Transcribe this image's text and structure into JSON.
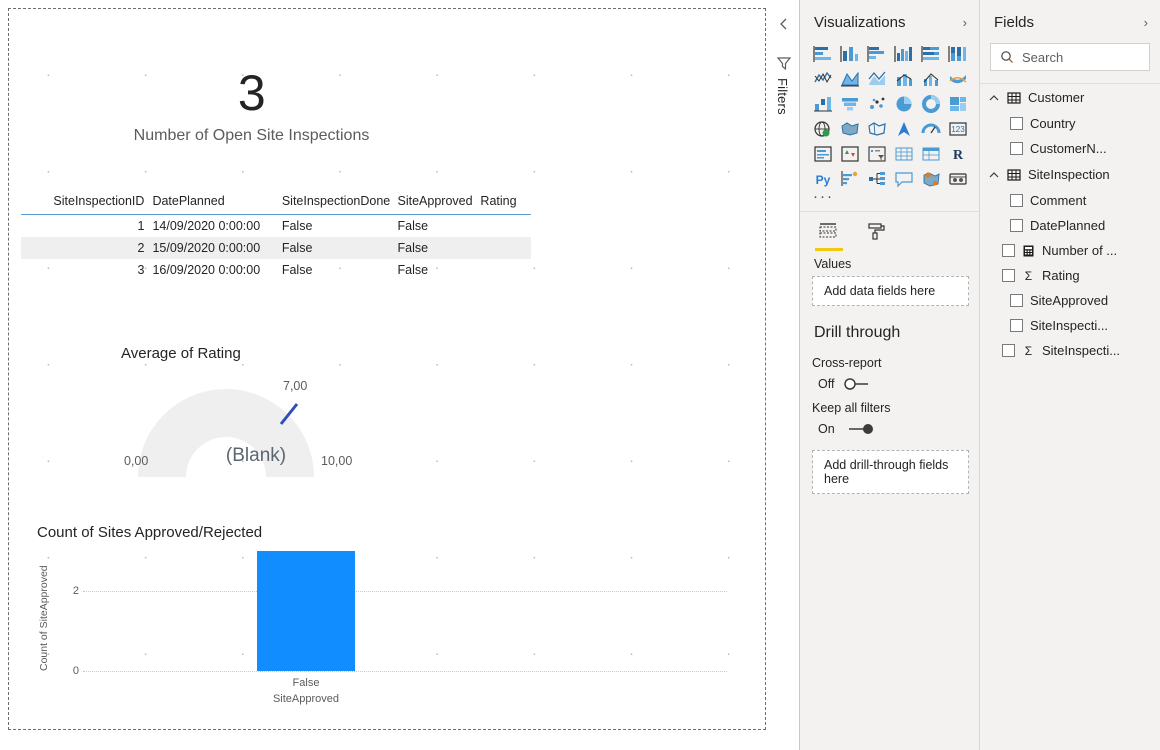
{
  "canvas": {
    "card": {
      "value": "3",
      "label": "Number of Open Site Inspections"
    },
    "table": {
      "columns": [
        "SiteInspectionID",
        "DatePlanned",
        "SiteInspectionDone",
        "SiteApproved",
        "Rating"
      ],
      "rows": [
        [
          "1",
          "14/09/2020 0:00:00",
          "False",
          "False",
          ""
        ],
        [
          "2",
          "15/09/2020 0:00:00",
          "False",
          "False",
          ""
        ],
        [
          "3",
          "16/09/2020 0:00:00",
          "False",
          "False",
          ""
        ]
      ]
    },
    "gauge": {
      "title": "Average of Rating",
      "center_value": "(Blank)",
      "min_label": "0,00",
      "max_label": "10,00",
      "target_label": "7,00"
    },
    "bar_chart": {
      "title": "Count of Sites Approved/Rejected"
    }
  },
  "chart_data": [
    {
      "type": "bar",
      "title": "Count of Sites Approved/Rejected",
      "categories": [
        "False"
      ],
      "values": [
        3
      ],
      "xlabel": "SiteApproved",
      "ylabel": "Count of SiteApproved",
      "ylim": [
        0,
        3.2
      ],
      "yticks": [
        "0",
        "2"
      ],
      "ytick_values": [
        0,
        2
      ],
      "grid": true,
      "legend": "none",
      "bar_color": "#118DFF"
    },
    {
      "type": "gauge",
      "title": "Average of Rating",
      "value": null,
      "value_label": "(Blank)",
      "min": 0,
      "max": 10,
      "target": 7,
      "min_label": "0,00",
      "max_label": "10,00",
      "target_label": "7,00",
      "arc_color": "#EFEFEF",
      "target_color": "#2F4FB8"
    }
  ],
  "filters_rail": {
    "expand_label": "‹",
    "label": "Filters"
  },
  "visualizations": {
    "title": "Visualizations",
    "chevron": "›",
    "icons": [
      "stacked-bar-chart-icon",
      "stacked-column-chart-icon",
      "clustered-bar-chart-icon",
      "clustered-column-chart-icon",
      "hundred-percent-stacked-bar-chart-icon",
      "hundred-percent-stacked-column-chart-icon",
      "line-chart-icon",
      "area-chart-icon",
      "stacked-area-chart-icon",
      "line-stacked-column-chart-icon",
      "line-clustered-column-chart-icon",
      "ribbon-chart-icon",
      "waterfall-chart-icon",
      "funnel-chart-icon",
      "scatter-chart-icon",
      "pie-chart-icon",
      "donut-chart-icon",
      "treemap-icon",
      "map-icon",
      "filled-map-icon",
      "shape-map-icon",
      "arcgis-map-icon",
      "gauge-icon",
      "card-icon",
      "multi-row-card-icon",
      "kpi-icon",
      "slicer-icon",
      "table-icon",
      "matrix-icon",
      "r-script-visual-icon",
      "python-visual-icon",
      "key-influencers-icon",
      "decomposition-tree-icon",
      "smart-narrative-icon",
      "azure-map-icon",
      "paginated-report-icon"
    ],
    "more_label": "···",
    "tabs": [
      {
        "name": "fields-tab",
        "icon": "fields-well-icon",
        "active": true
      },
      {
        "name": "format-tab",
        "icon": "paint-roller-icon",
        "active": false
      }
    ],
    "values_well": {
      "label": "Values",
      "placeholder": "Add data fields here"
    },
    "drill_through": {
      "title": "Drill through",
      "cross_report": {
        "label": "Cross-report",
        "state": "Off",
        "on": false
      },
      "keep_all_filters": {
        "label": "Keep all filters",
        "state": "On",
        "on": true
      },
      "dropzone": "Add drill-through fields here"
    }
  },
  "fields": {
    "title": "Fields",
    "chevron": "›",
    "search": {
      "placeholder": "Search",
      "value": ""
    },
    "tables": [
      {
        "name": "Customer",
        "expanded": true,
        "fields": [
          {
            "name": "Country",
            "type": "none",
            "checked": false
          },
          {
            "name": "CustomerN...",
            "type": "none",
            "checked": false
          }
        ]
      },
      {
        "name": "SiteInspection",
        "expanded": true,
        "fields": [
          {
            "name": "Comment",
            "type": "none",
            "checked": false
          },
          {
            "name": "DatePlanned",
            "type": "none",
            "checked": false
          },
          {
            "name": "Number of ...",
            "type": "measure",
            "checked": false
          },
          {
            "name": "Rating",
            "type": "sum",
            "checked": false
          },
          {
            "name": "SiteApproved",
            "type": "none",
            "checked": false
          },
          {
            "name": "SiteInspecti...",
            "type": "none",
            "checked": false
          },
          {
            "name": "SiteInspecti...",
            "type": "sum",
            "checked": false
          }
        ]
      }
    ]
  }
}
